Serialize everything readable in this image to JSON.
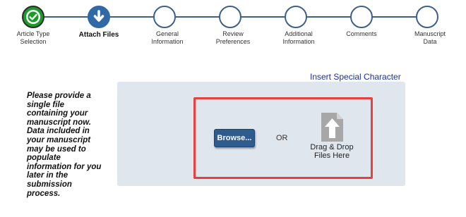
{
  "stepper": {
    "steps": [
      {
        "label": "Article Type Selection",
        "status": "complete",
        "icon": "checkmark-icon"
      },
      {
        "label": "Attach Files",
        "status": "current",
        "icon": "arrow-down-icon"
      },
      {
        "label": "General Information",
        "status": "pending"
      },
      {
        "label": "Review Preferences",
        "status": "pending"
      },
      {
        "label": "Additional Information",
        "status": "pending"
      },
      {
        "label": "Comments",
        "status": "pending"
      },
      {
        "label": "Manuscript Data",
        "status": "pending"
      }
    ]
  },
  "insert_special_character": "Insert Special Character",
  "instructions": "Please provide a single file containing your manuscript now. Data included in your manuscript may be used to populate information for you later in the submission process.",
  "upload": {
    "browse_label": "Browse...",
    "or_label": "OR",
    "drop_label": "Drag & Drop Files Here",
    "drop_icon": "upload-file-icon"
  },
  "colors": {
    "complete": "#1c9a2a",
    "current": "#2f6aa6",
    "step_border": "#3d5f88",
    "highlight_border": "#e8403c",
    "panel_bg": "#dfe6ee",
    "link": "#1b2fa8"
  }
}
